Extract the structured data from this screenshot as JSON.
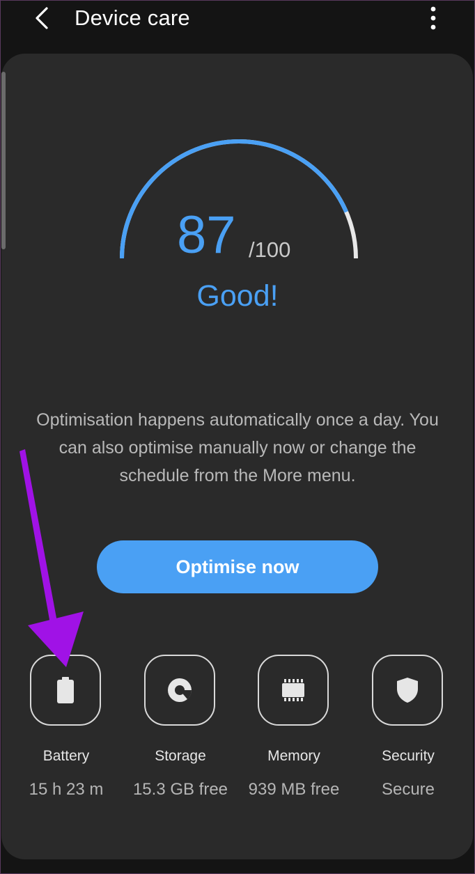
{
  "header": {
    "title": "Device care",
    "back_icon": "chevron-left-icon",
    "more_icon": "more-vert-icon"
  },
  "score": {
    "value": "87",
    "max": "/100",
    "status": "Good!",
    "fraction": 0.87
  },
  "description": "Optimisation happens automatically once a day. You can also optimise manually now or change the schedule from the More menu.",
  "optimise_button": "Optimise now",
  "tiles": [
    {
      "label": "Battery",
      "value": "15 h 23 m",
      "icon": "battery-icon"
    },
    {
      "label": "Storage",
      "value": "15.3 GB free",
      "icon": "storage-pie-icon"
    },
    {
      "label": "Memory",
      "value": "939 MB free",
      "icon": "memory-chip-icon"
    },
    {
      "label": "Security",
      "value": "Secure",
      "icon": "shield-icon"
    }
  ],
  "colors": {
    "accent": "#4aa0f4",
    "background": "#141414",
    "card": "#2a2a2a",
    "annotation_arrow": "#a012e6"
  }
}
